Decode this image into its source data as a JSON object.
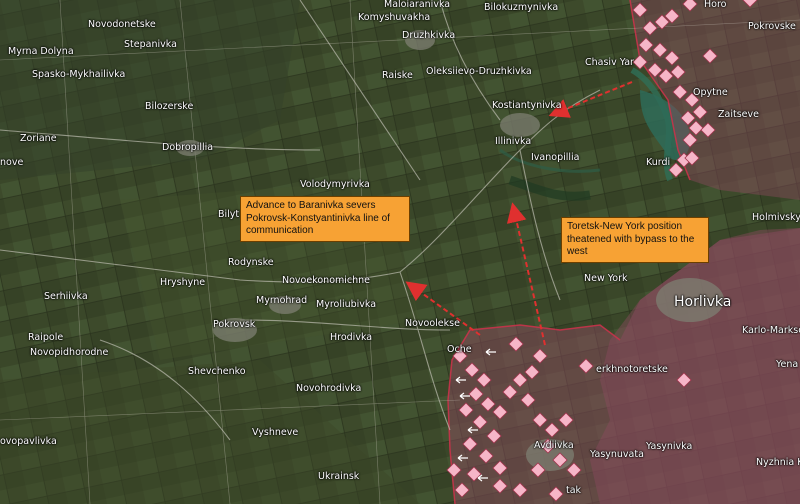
{
  "colors": {
    "occupied_fill": "#8a4a5e",
    "marker": "#f6b6c8",
    "arrow": "#e0302f",
    "callout_bg": "#f7a234"
  },
  "callouts": {
    "baranivka": "Advance to Baranivka severs Pokrovsk-Konstyantinivka line of communication",
    "toretsk": "Toretsk-New York position theatened with bypass to the west"
  },
  "places": {
    "novodonetske": "Novodonetske",
    "stepanivka": "Stepanivka",
    "myrna_dolyna": "Myrna Dolyna",
    "spasko_mykhailivka": "Spasko-Mykhailivka",
    "bilozerske": "Bilozerske",
    "zoriane": "Zoriane",
    "nove": "nove",
    "dobropillia": "Dobropillia",
    "volodymyrivka": "Volodymyrivka",
    "bilyt": "Bilyt",
    "rodynske": "Rodynske",
    "hryshyne": "Hryshyne",
    "serhiivka": "Serhiivka",
    "novoekonomichne": "Novoekonomichne",
    "myrnohrad": "Myrnohrad",
    "myroliubivka": "Myroliubivka",
    "pokrovsk": "Pokrovsk",
    "raipole": "Raipole",
    "novopidhorodne": "Novopidhorodne",
    "hrodivka": "Hrodivka",
    "shevchenko": "Shevchenko",
    "novohrodivka": "Novohrodivka",
    "vyshneve": "Vyshneve",
    "novopavlivka": "ovopavlivka",
    "ukrainsk": "Ukrainsk",
    "komyshuvakha": "Komyshuvakha",
    "maloiaranivka": "Maloiaranivka",
    "bilokuzmynivka": "Bilokuzmynivka",
    "druzhkivka": "Druzhkivka",
    "raiske": "Raiske",
    "oleksiievo": "Oleksiievo-Druzhkivka",
    "kostiantynivka": "Kostiantynivka",
    "illinivka": "Illinivka",
    "ivanopillia": "Ivanopillia",
    "chasiv_yar": "Chasiv Yar",
    "opytne": "Opytne",
    "zaitseve": "Zaitseve",
    "pokrovske": "Pokrovske",
    "kurdiumivka": "Kurdi",
    "holmivskyi": "Holmivskyi",
    "new_york": "New York",
    "horlivka": "Horlivka",
    "karlo_marksove": "Karlo-Markso",
    "yenakiieve": "Yena",
    "novooleksandrivka": "Novoolekse",
    "ocheretyne": "Oche",
    "verkhnotoretske": "erkhnotoretske",
    "avdiivka": "Avdiivka",
    "yasynuvata": "Yasynuvata",
    "yasynivka": "Yasynivka",
    "nyzhnia_krynka": "Nyzhnia Krin",
    "stak": "tak",
    "horo": "Horo"
  }
}
